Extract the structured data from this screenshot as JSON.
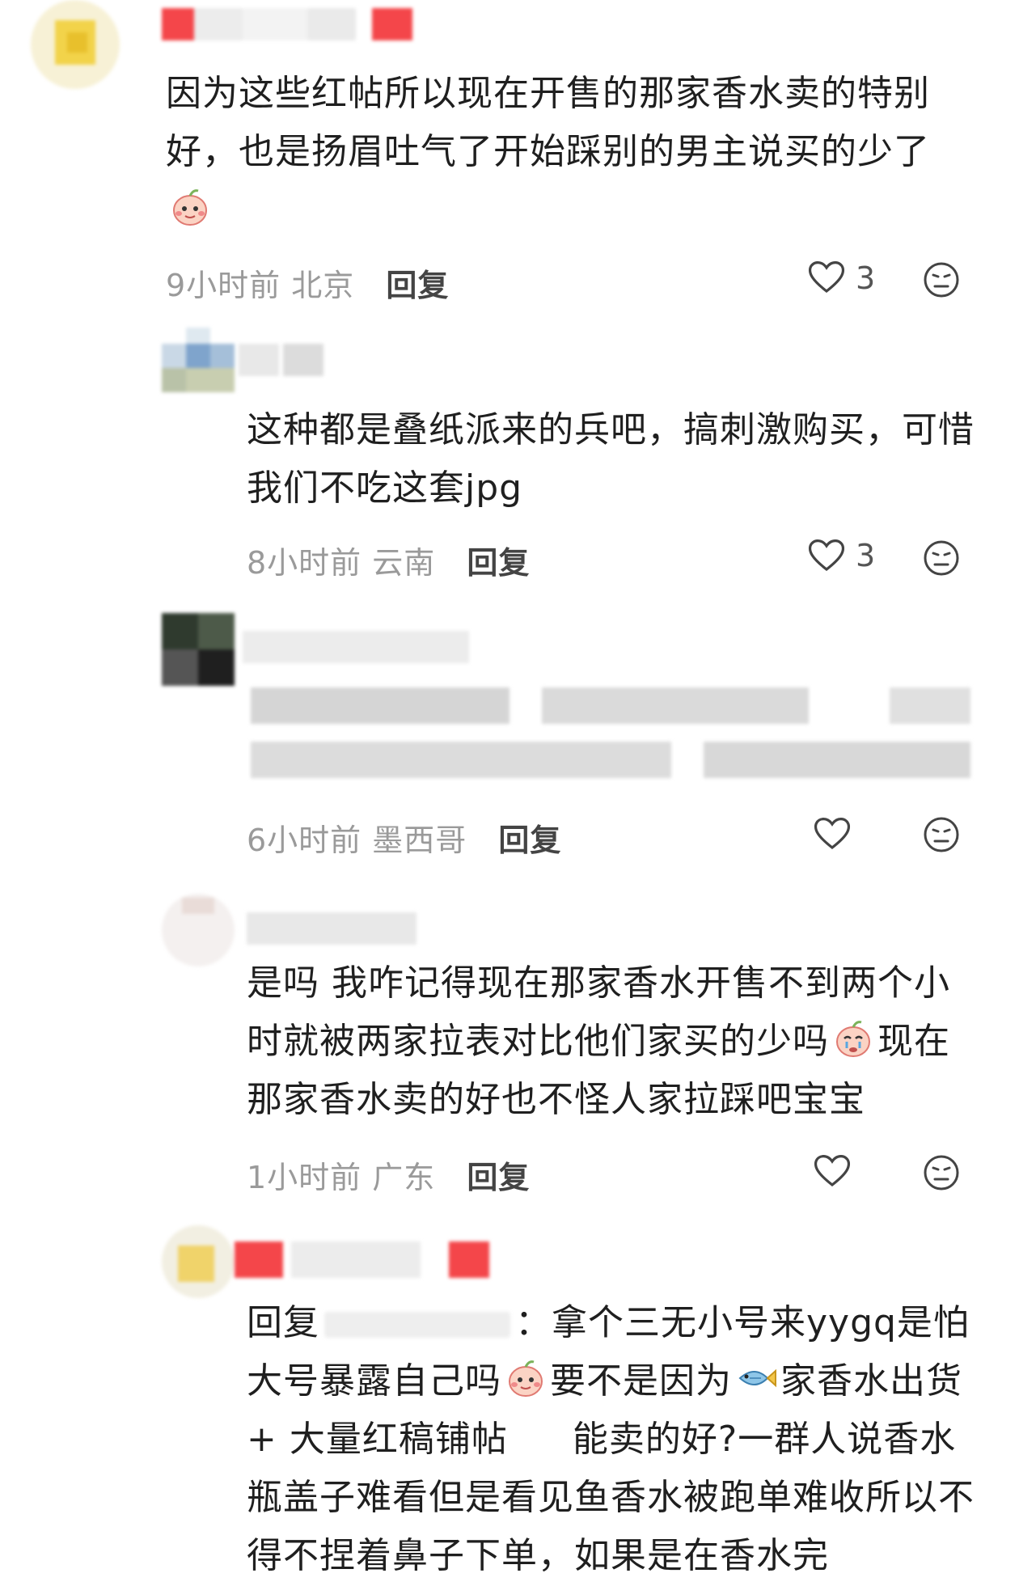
{
  "comments": [
    {
      "text": "因为这些红帖所以现在开售的那家香水卖的特别好，也是扬眉吐气了开始踩别的男主说买的少了",
      "time": "9小时前",
      "location": "北京",
      "reply_label": "回复",
      "likes": "3"
    },
    {
      "text": "这种都是叠纸派来的兵吧，搞刺激购买，可惜我们不吃这套jpg",
      "time": "8小时前",
      "location": "云南",
      "reply_label": "回复",
      "likes": "3"
    },
    {
      "text": "",
      "time": "6小时前",
      "location": "墨西哥",
      "reply_label": "回复",
      "likes": ""
    },
    {
      "text_part1": "是吗 我咋记得现在那家香水开售不到两个小时就被两家拉表对比他们家买的少吗",
      "text_part2": "现在那家香水卖的好也不怪人家拉踩吧宝宝",
      "time": "1小时前",
      "location": "广东",
      "reply_label": "回复",
      "likes": ""
    },
    {
      "reply_prefix": "回复",
      "colon": "：",
      "text_part1": "拿个三无小号来yygq是怕大号暴露自己吗",
      "text_part2": "要不是因为",
      "text_part3": "家香水出货 + 大量红稿铺帖",
      "text_part4": "能卖的好?一群人说香水瓶盖子难看但是看见鱼香水被跑单难收所以不得不捏着鼻子下单，如果是在香水完"
    }
  ],
  "icons": {
    "like": "heart-outline-icon",
    "dislike": "meh-face-icon",
    "emoji_tear": "crying-peach-emoji",
    "emoji_fish": "fish-emoji"
  },
  "colors": {
    "meta": "#9a9a9a",
    "text": "#1f1f1f"
  }
}
